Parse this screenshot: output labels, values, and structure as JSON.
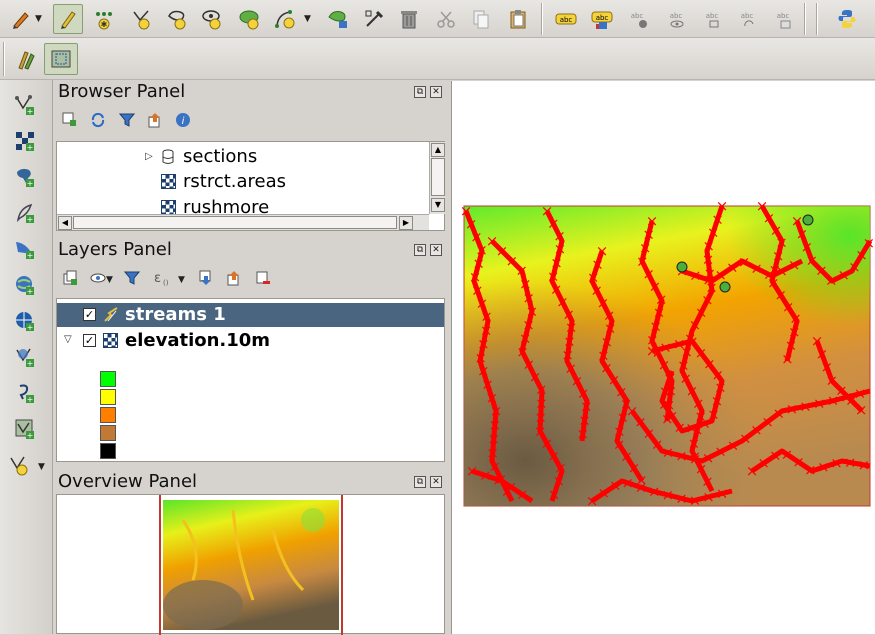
{
  "browser_panel": {
    "title": "Browser Panel",
    "items": [
      {
        "label": "sections"
      },
      {
        "label": "rstrct.areas"
      },
      {
        "label": "rushmore"
      }
    ]
  },
  "layers_panel": {
    "title": "Layers Panel",
    "layers": [
      {
        "label": "streams 1",
        "checked": true,
        "selected": true
      },
      {
        "label": "elevation.10m",
        "checked": true,
        "selected": false
      }
    ],
    "legend_colors": [
      "#00ff00",
      "#ffff00",
      "#ff8000",
      "#c07a36",
      "#000000"
    ]
  },
  "overview_panel": {
    "title": "Overview Panel"
  },
  "toolbar": {
    "label_icon_text": "abc"
  },
  "colors": {
    "selected_row": "#4a6580",
    "stream": "#ff0000",
    "accent": "#6b9e3a"
  }
}
